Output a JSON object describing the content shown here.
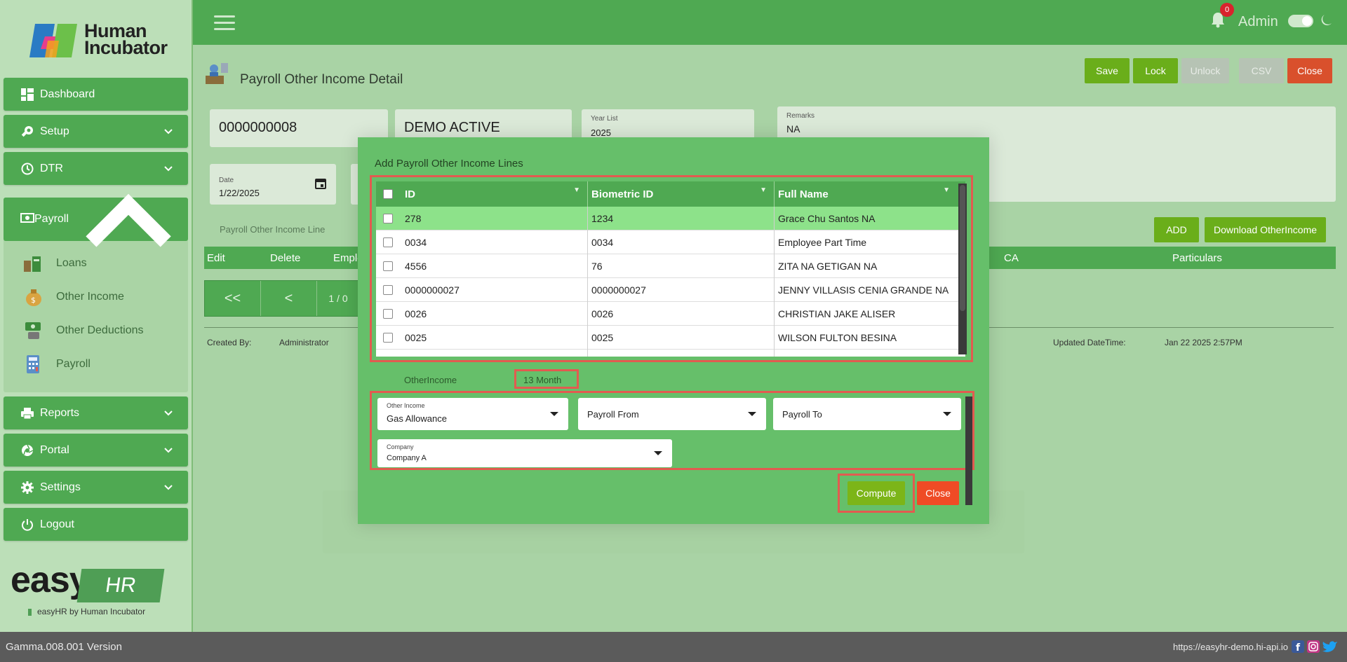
{
  "brand": {
    "company_line1": "Human",
    "company_line2": "Incubator",
    "easy_word": "easy",
    "hr_word": "HR",
    "tagline": "easyHR by Human Incubator"
  },
  "sidebar": {
    "items": [
      {
        "label": "Dashboard"
      },
      {
        "label": "Setup"
      },
      {
        "label": "DTR"
      },
      {
        "label": "Payroll"
      },
      {
        "label": "Reports"
      },
      {
        "label": "Portal"
      },
      {
        "label": "Settings"
      },
      {
        "label": "Logout"
      }
    ],
    "payroll_sub": [
      {
        "label": "Loans"
      },
      {
        "label": "Other Income"
      },
      {
        "label": "Other Deductions"
      },
      {
        "label": "Payroll"
      }
    ]
  },
  "topbar": {
    "notif_count": "0",
    "user": "Admin"
  },
  "page": {
    "title": "Payroll Other Income Detail",
    "toolbar": {
      "save": "Save",
      "lock": "Lock",
      "unlock": "Unlock",
      "csv": "CSV",
      "close": "Close"
    },
    "number_value": "0000000008",
    "status_value": "DEMO ACTIVE",
    "year_label": "Year List",
    "year_value": "2025",
    "remarks_label": "Remarks",
    "remarks_value": "NA",
    "date_label": "Date",
    "date_value": "1/22/2025",
    "section_label": "Payroll Other Income Line",
    "add_button": "ADD",
    "download_button": "Download OtherIncome",
    "grid_headers": {
      "edit": "Edit",
      "delete": "Delete",
      "emp": "Emple",
      "ca": "CA",
      "particulars": "Particulars"
    },
    "pager": {
      "first": "<<",
      "prev": "<",
      "info": "1 / 0"
    },
    "created_by_label": "Created By:",
    "created_by_value": "Administrator",
    "updated_label": "Updated DateTime:",
    "updated_value": "Jan 22 2025 2:57PM"
  },
  "modal": {
    "title": "Add Payroll Other Income Lines",
    "columns": [
      "ID",
      "Biometric ID",
      "Full Name"
    ],
    "rows": [
      {
        "id": "278",
        "bio": "1234",
        "name": "Grace Chu Santos NA",
        "selected": true
      },
      {
        "id": "0034",
        "bio": "0034",
        "name": "Employee Part Time",
        "selected": false
      },
      {
        "id": "4556",
        "bio": "76",
        "name": "ZITA NA GETIGAN NA",
        "selected": false
      },
      {
        "id": "0000000027",
        "bio": "0000000027",
        "name": "JENNY VILLASIS CENIA GRANDE NA",
        "selected": false
      },
      {
        "id": "0026",
        "bio": "0026",
        "name": "CHRISTIAN JAKE ALISER",
        "selected": false
      },
      {
        "id": "0025",
        "bio": "0025",
        "name": "WILSON FULTON BESINA",
        "selected": false
      }
    ],
    "other_income_caption": "OtherIncome",
    "month_caption": "13 Month",
    "other_income_label": "Other Income",
    "other_income_value": "Gas Allowance",
    "payroll_from": "Payroll From",
    "payroll_to": "Payroll To",
    "company_label": "Company",
    "company_value": "Company A",
    "compute_button": "Compute",
    "close_button": "Close"
  },
  "footer": {
    "version": "Gamma.008.001 Version",
    "url": "https://easyhr-demo.hi-api.io"
  },
  "colors": {
    "primary_green": "#4fa952",
    "modal_green": "#66bf6a",
    "lime_button": "#7cb518",
    "close_red": "#ef4b25",
    "highlight_red": "#e25b50"
  }
}
